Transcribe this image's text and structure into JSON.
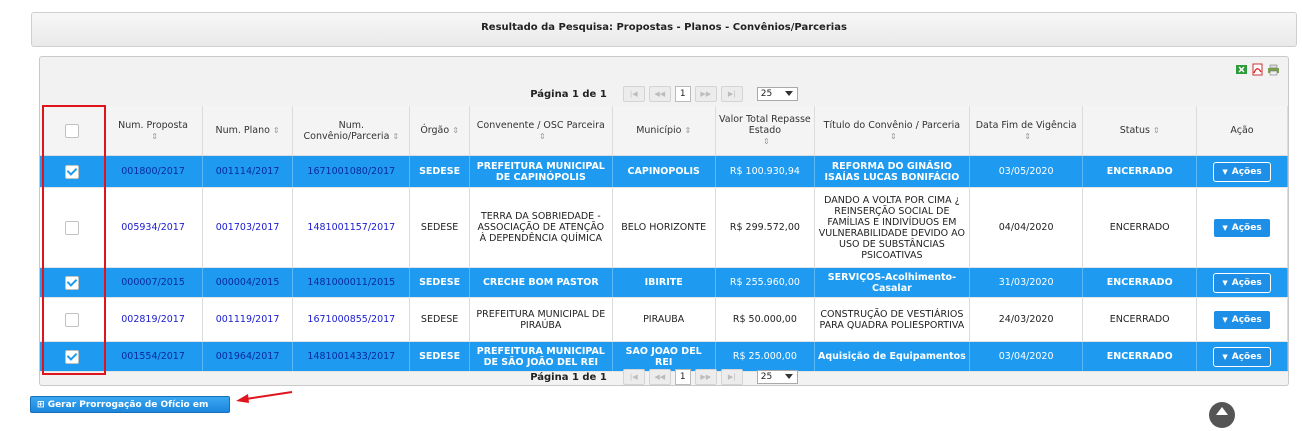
{
  "panel": {
    "title": "Resultado da Pesquisa: Propostas - Planos - Convênios/Parcerias"
  },
  "toolbar_icons": [
    "excel-icon",
    "pdf-icon",
    "print-icon"
  ],
  "pager": {
    "label": "Página 1 de 1",
    "first": "|◀",
    "prev": "◀◀",
    "page": "1",
    "next": "▶▶",
    "last": "▶|",
    "page_size": "25"
  },
  "columns": [
    {
      "label": "",
      "sortable": false
    },
    {
      "label": "Num. Proposta",
      "sortable": true
    },
    {
      "label": "Num. Plano",
      "sortable": true
    },
    {
      "label": "Num. Convênio/Parceria",
      "sortable": true
    },
    {
      "label": "Órgão",
      "sortable": true
    },
    {
      "label": "Convenente / OSC Parceira",
      "sortable": true
    },
    {
      "label": "Município",
      "sortable": true
    },
    {
      "label": "Valor Total Repasse Estado",
      "sortable": true
    },
    {
      "label": "Título do Convênio / Parceria",
      "sortable": true
    },
    {
      "label": "Data Fim de Vigência",
      "sortable": true
    },
    {
      "label": "Status",
      "sortable": true
    },
    {
      "label": "Ação",
      "sortable": false
    }
  ],
  "rows": [
    {
      "selected": true,
      "proposta": "001800/2017",
      "plano": "001114/2017",
      "convenio": "1671001080/2017",
      "orgao": "SEDESE",
      "convenente": "PREFEITURA MUNICIPAL DE CAPINÓPOLIS",
      "municipio": "CAPINOPOLIS",
      "valor": "R$ 100.930,94",
      "titulo": "REFORMA DO GINÁSIO ISAÍAS LUCAS BONIFÁCIO",
      "data_fim": "03/05/2020",
      "status": "ENCERRADO",
      "acao": "Ações"
    },
    {
      "selected": false,
      "proposta": "005934/2017",
      "plano": "001703/2017",
      "convenio": "1481001157/2017",
      "orgao": "SEDESE",
      "convenente": "TERRA DA SOBRIEDADE - ASSOCIAÇÃO DE ATENÇÃO À DEPENDÊNCIA QUÍMICA",
      "municipio": "BELO HORIZONTE",
      "valor": "R$ 299.572,00",
      "titulo": "DANDO A VOLTA POR CIMA ¿ REINSERÇÃO SOCIAL DE FAMÍLIAS E INDIVÍDUOS EM VULNERABILIDADE DEVIDO AO USO DE SUBSTÂNCIAS PSICOATIVAS",
      "data_fim": "04/04/2020",
      "status": "ENCERRADO",
      "acao": "Ações"
    },
    {
      "selected": true,
      "proposta": "000007/2015",
      "plano": "000004/2015",
      "convenio": "1481000011/2015",
      "orgao": "SEDESE",
      "convenente": "CRECHE BOM PASTOR",
      "municipio": "IBIRITE",
      "valor": "R$ 255.960,00",
      "titulo": "SERVIÇOS-Acolhimento-Casalar",
      "data_fim": "31/03/2020",
      "status": "ENCERRADO",
      "acao": "Ações"
    },
    {
      "selected": false,
      "proposta": "002819/2017",
      "plano": "001119/2017",
      "convenio": "1671000855/2017",
      "orgao": "SEDESE",
      "convenente": "PREFEITURA MUNICIPAL DE PIRAÚBA",
      "municipio": "PIRAUBA",
      "valor": "R$ 50.000,00",
      "titulo": "CONSTRUÇÃO DE VESTIÁRIOS PARA QUADRA POLIESPORTIVA",
      "data_fim": "24/03/2020",
      "status": "ENCERRADO",
      "acao": "Ações"
    },
    {
      "selected": true,
      "proposta": "001554/2017",
      "plano": "001964/2017",
      "convenio": "1481001433/2017",
      "orgao": "SEDESE",
      "convenente": "PREFEITURA MUNICIPAL DE SÃO JOÃO DEL REI",
      "municipio": "SAO JOAO DEL REI",
      "valor": "R$ 25.000,00",
      "titulo": "Aquisição de Equipamentos",
      "data_fim": "03/04/2020",
      "status": "ENCERRADO",
      "acao": "Ações"
    }
  ],
  "footer": {
    "button_label": "Gerar Prorrogação de Ofício em Lote"
  },
  "colors": {
    "selected_row": "#1e9bf0",
    "link": "#1a1ad0",
    "annotation": "#e0141d"
  }
}
